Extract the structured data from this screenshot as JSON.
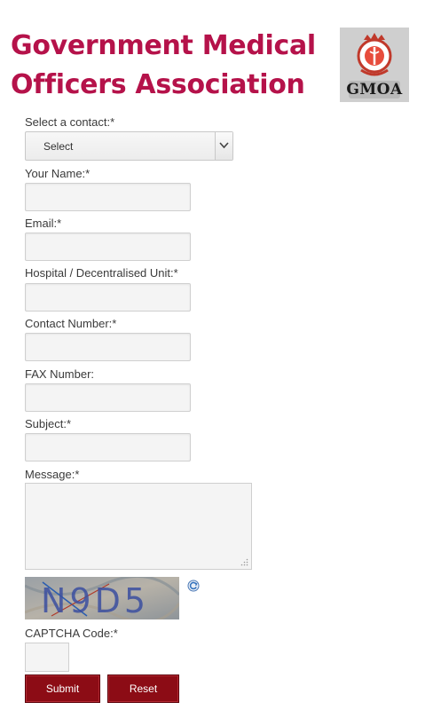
{
  "header": {
    "title_line1": "Government Medical",
    "title_line2": "Officers Association",
    "logo_text": "GMOA",
    "brand_color": "#b5124a"
  },
  "form": {
    "contact_label": "Select a contact:*",
    "contact_selected": "Select",
    "name_label": "Your Name:*",
    "email_label": "Email:*",
    "hospital_label": "Hospital / Decentralised Unit:*",
    "contact_number_label": "Contact Number:*",
    "fax_label": "FAX Number:",
    "subject_label": "Subject:*",
    "message_label": "Message:*",
    "captcha_image_text": "N9D5",
    "captcha_label": "CAPTCHA Code:*",
    "submit_label": "Submit",
    "reset_label": "Reset",
    "button_color": "#8c0c15"
  }
}
